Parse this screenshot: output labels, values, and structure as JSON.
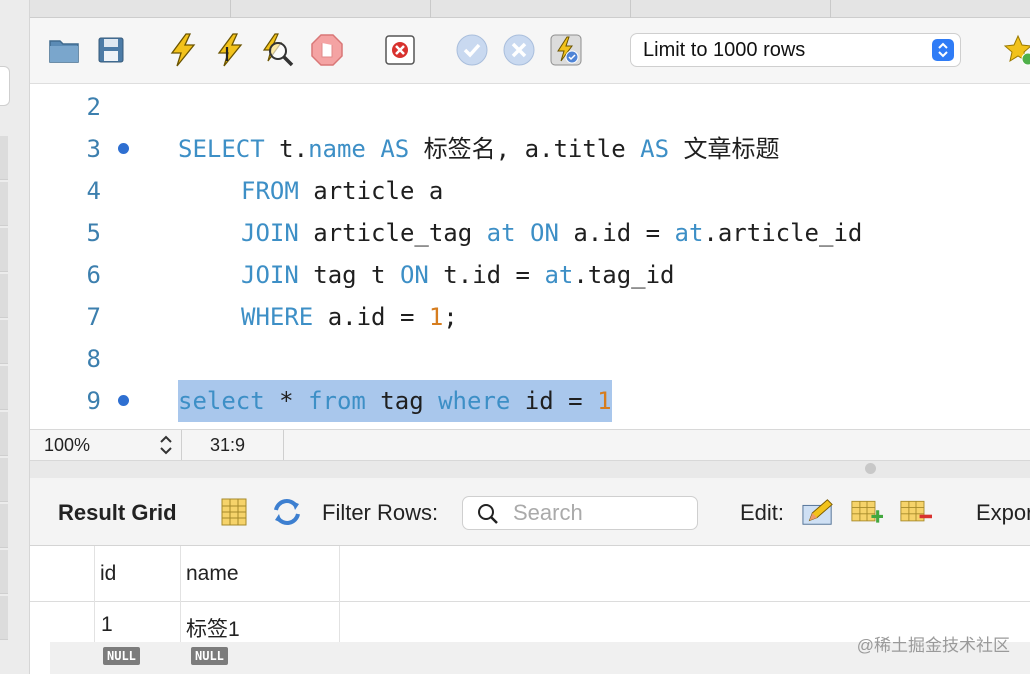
{
  "toolbar": {
    "limit_select": "Limit to 1000 rows",
    "icons": [
      "open-folder-icon",
      "save-icon",
      "execute-icon",
      "execute-current-icon",
      "explain-icon",
      "stop-icon",
      "toggle-error-icon",
      "commit-icon",
      "rollback-icon",
      "autocommit-icon",
      "bookmark-star-icon"
    ]
  },
  "editor": {
    "lines": [
      {
        "num": "2"
      },
      {
        "num": "3",
        "t1": "SELECT",
        "t2": " t.",
        "t3": "name",
        "t4": " ",
        "t5": "AS",
        "t6": " 标签名, a.title ",
        "t7": "AS",
        "t8": " 文章标题"
      },
      {
        "num": "4",
        "t1": "FROM",
        "t2": " article a"
      },
      {
        "num": "5",
        "t1": "JOIN",
        "t2": " article_tag ",
        "t3": "at",
        "t4": " ",
        "t5": "ON",
        "t6": " a.id = ",
        "t7": "at",
        "t8": ".article_id"
      },
      {
        "num": "6",
        "t1": "JOIN",
        "t2": " tag t ",
        "t3": "ON",
        "t4": " t.id = ",
        "t5": "at",
        "t6": ".tag_id"
      },
      {
        "num": "7",
        "t1": "WHERE",
        "t2": " a.id = ",
        "t3": "1",
        "t4": ";"
      },
      {
        "num": "8"
      },
      {
        "num": "9",
        "t1": "select",
        "t2": " * ",
        "t3": "from",
        "t4": " tag ",
        "t5": "where",
        "t6": " id = ",
        "t7": "1"
      }
    ]
  },
  "status": {
    "zoom": "100%",
    "cursor": "31:9"
  },
  "result": {
    "label": "Result Grid",
    "filter_label": "Filter Rows:",
    "search_placeholder": "Search",
    "edit_label": "Edit:",
    "export_label": "Expor",
    "columns": [
      "id",
      "name"
    ],
    "rows": [
      [
        "1",
        "标签1"
      ],
      [
        "NULL",
        "NULL"
      ]
    ]
  },
  "watermark": "@稀土掘金技术社区",
  "colors": {
    "keyword": "#3d8fc6",
    "number": "#d67d1f",
    "selection": "#a9c7ec",
    "line_number": "#3c7fae"
  }
}
